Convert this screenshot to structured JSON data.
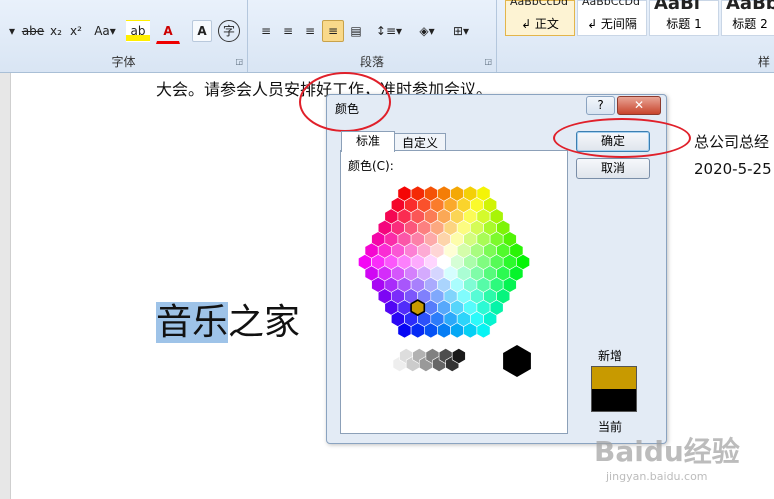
{
  "ribbon": {
    "font_group_label": "字体",
    "para_group_label": "段落",
    "styles_group_label": "样",
    "font_buttons": [
      "abe",
      "x₂",
      "x²",
      "Aa▾",
      "ab",
      "A",
      "A",
      "字"
    ],
    "styles": [
      {
        "preview": "AaBbCcDd",
        "label": "↲ 正文"
      },
      {
        "preview": "AaBbCcDd",
        "label": "↲ 无间隔"
      },
      {
        "preview": "AaBl",
        "label": "标题 1"
      },
      {
        "preview": "AaBb",
        "label": "标题 2"
      }
    ]
  },
  "document": {
    "line1": "大会。请参会人员安排好工作，准时参加会议。",
    "selected_text": "音乐",
    "rest_text": "之家",
    "right_line1": "总公司总经",
    "right_line2": "2020-5-25"
  },
  "dialog": {
    "title": "颜色",
    "help": "?",
    "close": "✕",
    "tabs": [
      "标准",
      "自定义"
    ],
    "colors_label": "颜色(C):",
    "ok": "确定",
    "cancel": "取消",
    "new_label": "新增",
    "current_label": "当前",
    "new_color": "#c89a00",
    "current_color": "#000000"
  },
  "watermark": {
    "brand": "Baidu经验",
    "url": "jingyan.baidu.com"
  }
}
